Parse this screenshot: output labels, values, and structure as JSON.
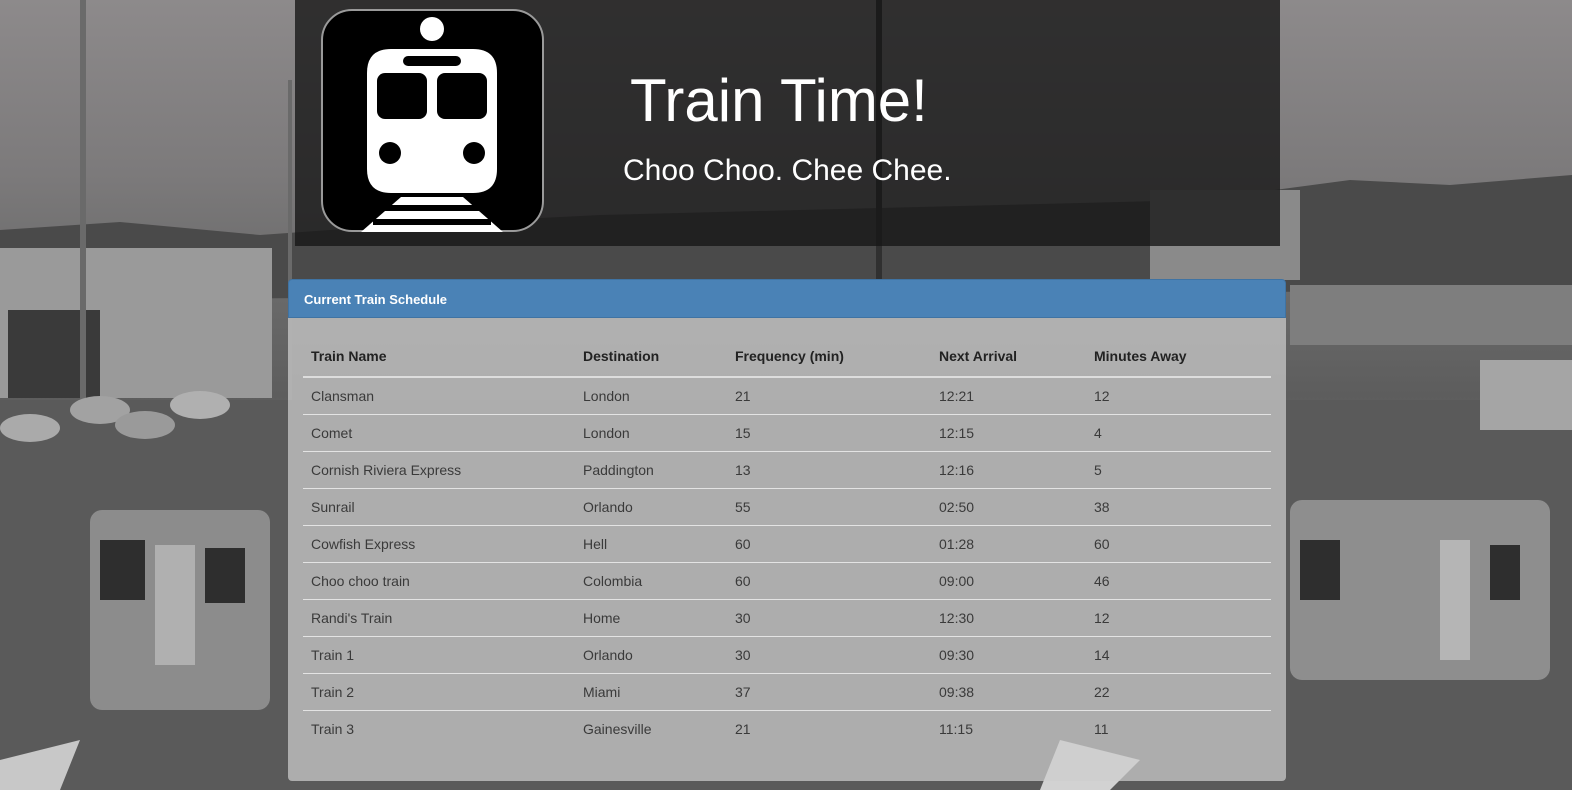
{
  "header": {
    "title": "Train Time!",
    "subtitle": "Choo Choo. Chee Chee.",
    "logo_icon": "train-front-icon"
  },
  "panel": {
    "title": "Current Train Schedule",
    "accent_color": "#4a82b6"
  },
  "table": {
    "columns": [
      "Train Name",
      "Destination",
      "Frequency (min)",
      "Next Arrival",
      "Minutes Away"
    ],
    "rows": [
      [
        "Clansman",
        "London",
        "21",
        "12:21",
        "12"
      ],
      [
        "Comet",
        "London",
        "15",
        "12:15",
        "4"
      ],
      [
        "Cornish Riviera Express",
        "Paddington",
        "13",
        "12:16",
        "5"
      ],
      [
        "Sunrail",
        "Orlando",
        "55",
        "02:50",
        "38"
      ],
      [
        "Cowfish Express",
        "Hell",
        "60",
        "01:28",
        "60"
      ],
      [
        "Choo choo train",
        "Colombia",
        "60",
        "09:00",
        "46"
      ],
      [
        "Randi's Train",
        "Home",
        "30",
        "12:30",
        "12"
      ],
      [
        "Train 1",
        "Orlando",
        "30",
        "09:30",
        "14"
      ],
      [
        "Train 2",
        "Miami",
        "37",
        "09:38",
        "22"
      ],
      [
        "Train 3",
        "Gainesville",
        "21",
        "11:15",
        "11"
      ]
    ]
  }
}
